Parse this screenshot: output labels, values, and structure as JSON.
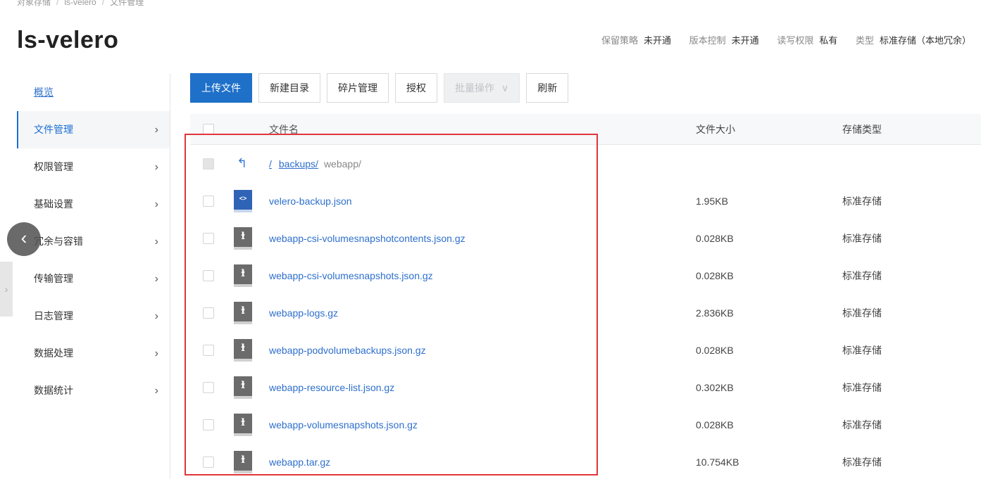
{
  "breadcrumb": [
    "对象存储",
    "ls-velero",
    "文件管理"
  ],
  "bucket": {
    "name": "ls-velero",
    "meta": [
      {
        "label": "保留策略",
        "value": "未开通"
      },
      {
        "label": "版本控制",
        "value": "未开通"
      },
      {
        "label": "读写权限",
        "value": "私有"
      },
      {
        "label": "类型",
        "value": "标准存储（本地冗余）"
      }
    ]
  },
  "sidebar": {
    "items": [
      {
        "label": "概览"
      },
      {
        "label": "文件管理"
      },
      {
        "label": "权限管理"
      },
      {
        "label": "基础设置"
      },
      {
        "label": "冗余与容错"
      },
      {
        "label": "传输管理"
      },
      {
        "label": "日志管理"
      },
      {
        "label": "数据处理"
      },
      {
        "label": "数据统计"
      }
    ]
  },
  "toolbar": {
    "upload": "上传文件",
    "new_dir": "新建目录",
    "fragments": "碎片管理",
    "authorize": "授权",
    "batch": "批量操作",
    "refresh": "刷新"
  },
  "table": {
    "headers": {
      "name": "文件名",
      "size": "文件大小",
      "type": "存储类型"
    },
    "path": {
      "root": "/",
      "parent": "backups/",
      "current": "webapp/"
    },
    "rows": [
      {
        "name": "velero-backup.json",
        "size": "1.95KB",
        "type": "标准存储",
        "icon": "json-file-icon"
      },
      {
        "name": "webapp-csi-volumesnapshotcontents.json.gz",
        "size": "0.028KB",
        "type": "标准存储",
        "icon": "archive-file-icon"
      },
      {
        "name": "webapp-csi-volumesnapshots.json.gz",
        "size": "0.028KB",
        "type": "标准存储",
        "icon": "archive-file-icon"
      },
      {
        "name": "webapp-logs.gz",
        "size": "2.836KB",
        "type": "标准存储",
        "icon": "archive-file-icon"
      },
      {
        "name": "webapp-podvolumebackups.json.gz",
        "size": "0.028KB",
        "type": "标准存储",
        "icon": "archive-file-icon"
      },
      {
        "name": "webapp-resource-list.json.gz",
        "size": "0.302KB",
        "type": "标准存储",
        "icon": "archive-file-icon"
      },
      {
        "name": "webapp-volumesnapshots.json.gz",
        "size": "0.028KB",
        "type": "标准存储",
        "icon": "archive-file-icon"
      },
      {
        "name": "webapp.tar.gz",
        "size": "10.754KB",
        "type": "标准存储",
        "icon": "archive-file-icon"
      }
    ]
  },
  "colors": {
    "primary": "#1f70c9",
    "link": "#2d6fcc",
    "highlight": "#e0353b"
  }
}
